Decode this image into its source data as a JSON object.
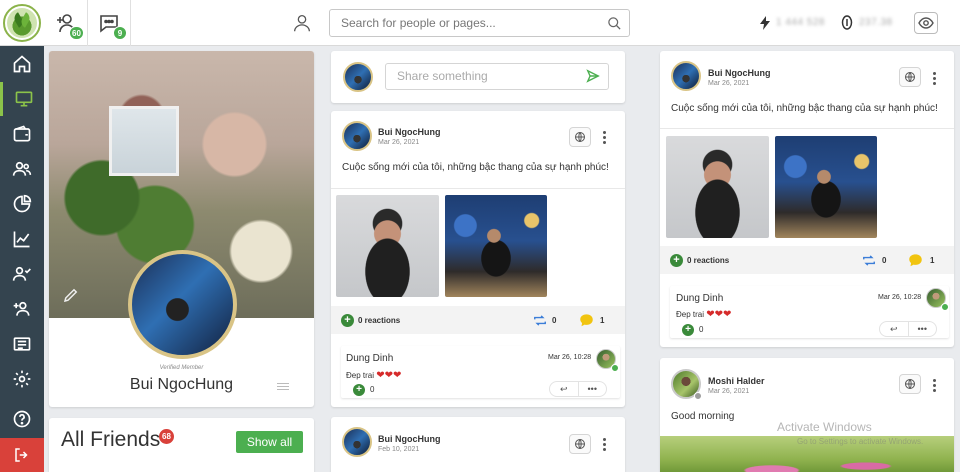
{
  "topbar": {
    "friend_requests_badge": "60",
    "messages_badge": "9",
    "search_placeholder": "Search for people or pages...",
    "stat1_blurred": "1 444 528",
    "stat2_blurred": "237.38"
  },
  "sidebar": {
    "items": [
      "home-icon",
      "monitor-icon",
      "wallet-icon",
      "users-icon",
      "pie-chart-icon",
      "line-chart-icon",
      "user-check-icon",
      "user-plus-icon",
      "newspaper-icon",
      "gear-icon",
      "help-icon"
    ],
    "logout": "logout-icon"
  },
  "profile": {
    "verified_label": "Verified Member",
    "name": "Bui NgocHung"
  },
  "friends": {
    "title": "All Friends",
    "count_badge": "68",
    "show_all_label": "Show all"
  },
  "share": {
    "placeholder": "Share something"
  },
  "post1": {
    "author": "Bui NgocHung",
    "date": "Mar 26, 2021",
    "text": "Cuộc sống mới của tôi, những bậc thang của sự hạnh phúc!",
    "reactions_label": "0 reactions",
    "shares": "0",
    "comments": "1",
    "comment": {
      "author": "Dung Dinh",
      "date": "Mar 26, 10:28",
      "text": "Đep trai",
      "hearts": "❤❤❤",
      "likes": "0"
    }
  },
  "post2": {
    "author": "Bui NgocHung",
    "date": "Feb 10, 2021"
  },
  "post3": {
    "author": "Bui NgocHung",
    "date": "Mar 26, 2021",
    "text": "Cuộc sống mới của tôi, những bậc thang của sự hạnh phúc!",
    "reactions_label": "0 reactions",
    "shares": "0",
    "comments": "1",
    "comment": {
      "author": "Dung Dinh",
      "date": "Mar 26, 10:28",
      "text": "Đep trai",
      "hearts": "❤❤❤",
      "likes": "0"
    }
  },
  "post4": {
    "author": "Moshi Halder",
    "date": "Mar 26, 2021",
    "text": "Good morning"
  },
  "watermark": {
    "line1": "Activate Windows",
    "line2": "Go to Settings to activate Windows."
  },
  "colors": {
    "accent_green": "#4caf50",
    "sidebar_bg": "#34444f",
    "logout_red": "#d9413a",
    "badge_red": "#d9413a"
  }
}
